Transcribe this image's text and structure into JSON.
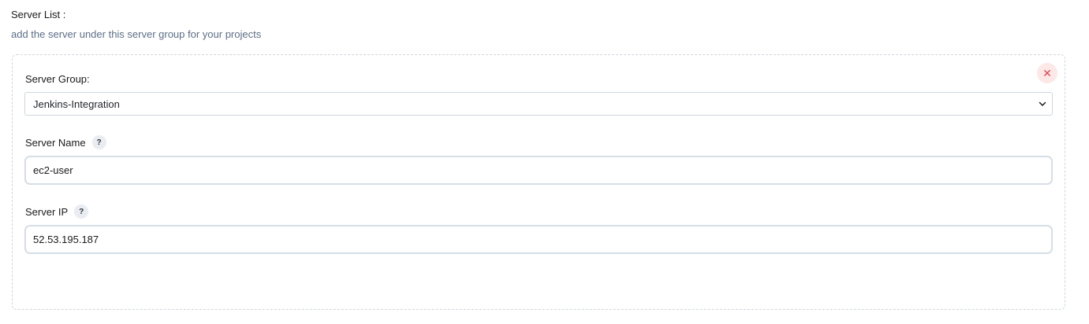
{
  "section": {
    "title": "Server List :",
    "description": "add the server under this server group for your projects"
  },
  "group_card": {
    "remove_icon": "close-icon",
    "remove_symbol": "✕",
    "server_group": {
      "label": "Server Group:",
      "selected": "Jenkins-Integration",
      "icon": "chevron-down-icon"
    },
    "server_name": {
      "label": "Server Name",
      "help_symbol": "?",
      "value": "ec2-user"
    },
    "server_ip": {
      "label": "Server IP",
      "help_symbol": "?",
      "value": "52.53.195.187"
    }
  },
  "colors": {
    "remove_bg": "#fde8e8",
    "remove_fg": "#e0454f",
    "description": "#5d6f86",
    "border": "#cfd6de"
  }
}
